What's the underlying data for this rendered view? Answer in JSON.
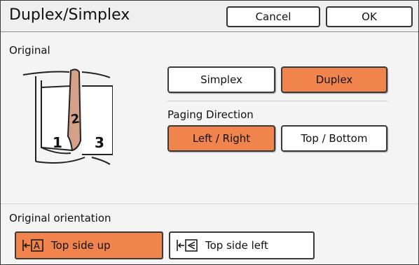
{
  "header": {
    "title": "Duplex/Simplex",
    "cancel_label": "Cancel",
    "ok_label": "OK"
  },
  "original": {
    "section_label": "Original",
    "illustration_pages": [
      "1",
      "2",
      "3"
    ],
    "simplex_label": "Simplex",
    "duplex_label": "Duplex",
    "selected": "Duplex"
  },
  "paging_direction": {
    "label": "Paging Direction",
    "left_right_label": "Left / Right",
    "top_bottom_label": "Top / Bottom",
    "selected": "Left / Right"
  },
  "orientation": {
    "section_label": "Original orientation",
    "top_side_up_label": "Top side up",
    "top_side_up_icon_letter": "A",
    "top_side_left_label": "Top side left",
    "selected": "Top side up"
  },
  "colors": {
    "accent": "#f0844c",
    "panel_bg": "#f4f4f4",
    "border": "#3a3a3a"
  }
}
